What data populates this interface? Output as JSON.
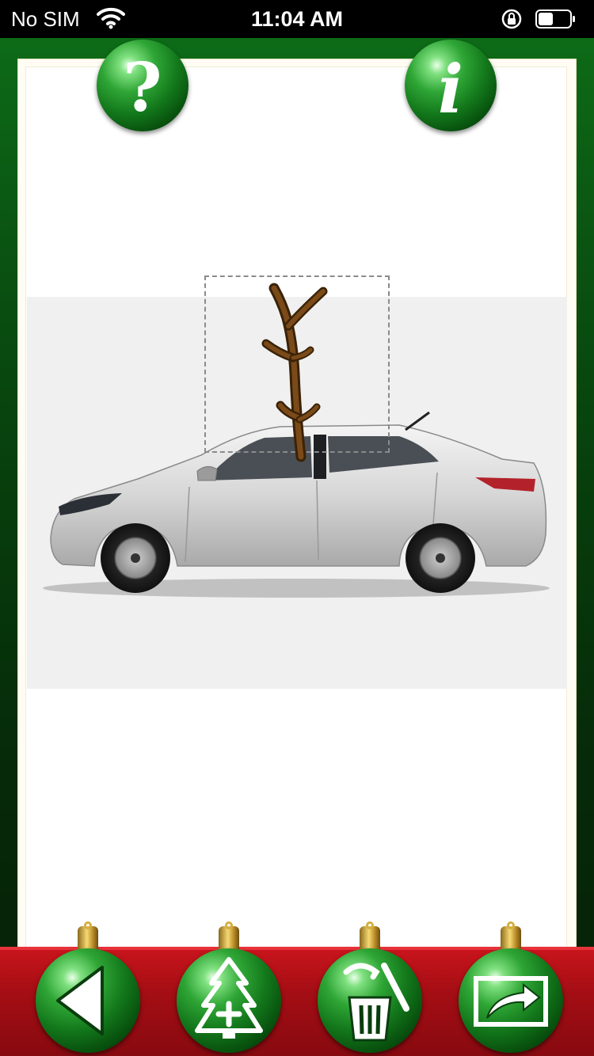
{
  "status_bar": {
    "carrier": "No SIM",
    "time": "11:04 AM"
  },
  "toolbar_top": {
    "help_icon": "question-mark-icon",
    "info_icon": "info-icon"
  },
  "canvas": {
    "photo": "silver-sedan-photo",
    "sticker": "reindeer-antler-sticker"
  },
  "toolbar_bottom": {
    "items": [
      {
        "name": "back",
        "icon": "back-arrow-icon"
      },
      {
        "name": "add-sticker",
        "icon": "christmas-tree-add-icon"
      },
      {
        "name": "delete",
        "icon": "trash-icon"
      },
      {
        "name": "share",
        "icon": "share-icon"
      }
    ]
  },
  "colors": {
    "felt_green": "#0a5412",
    "bar_red": "#a40e14",
    "orb_green": "#13781b"
  }
}
